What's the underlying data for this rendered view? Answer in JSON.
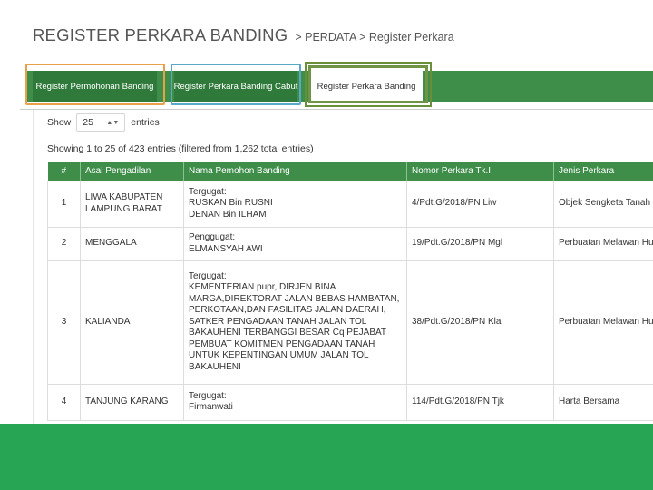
{
  "page": {
    "title": "REGISTER PERKARA BANDING",
    "breadcrumb": "> PERDATA > Register Perkara"
  },
  "tabs": [
    {
      "label": "Register Permohonan Banding",
      "active": false
    },
    {
      "label": "Register Perkara Banding Cabut",
      "active": false
    },
    {
      "label": "Register Perkara Banding",
      "active": true
    }
  ],
  "highlight_colors": {
    "orange": "#e8a04a",
    "blue": "#5aa8c8",
    "green": "#6a8f3a"
  },
  "length_menu": {
    "show_label": "Show",
    "value": "25",
    "entries_label": "entries"
  },
  "info": "Showing 1 to 25 of 423 entries (filtered from 1,262 total entries)",
  "table": {
    "columns": [
      "#",
      "Asal Pengadilan",
      "Nama Pemohon Banding",
      "Nomor Perkara Tk.I",
      "Jenis Perkara"
    ],
    "rows": [
      {
        "num": "1",
        "court": "LIWA KABUPATEN\nLAMPUNG BARAT",
        "names": "Tergugat:\nRUSKAN Bin RUSNI\nDENAN Bin ILHAM",
        "case_no": "4/Pdt.G/2018/PN Liw",
        "type": "Objek Sengketa Tanah"
      },
      {
        "num": "2",
        "court": "MENGGALA",
        "names": "Penggugat:\nELMANSYAH AWI",
        "case_no": "19/Pdt.G/2018/PN Mgl",
        "type": "Perbuatan Melawan Hukum"
      },
      {
        "num": "3",
        "court": "KALIANDA",
        "names": "Tergugat:\nKEMENTERIAN pupr, DIRJEN BINA\nMARGA,DIREKTORAT JALAN BEBAS HAMBATAN,\nPERKOTAAN,DAN FASILITAS JALAN DAERAH,\nSATKER PENGADAAN TANAH JALAN TOL\nBAKAUHENI TERBANGGI BESAR Cq PEJABAT\nPEMBUAT KOMITMEN PENGADAAN TANAH\nUNTUK KEPENTINGAN UMUM JALAN TOL\nBAKAUHENI",
        "case_no": "38/Pdt.G/2018/PN Kla",
        "type": "Perbuatan Melawan Hukum"
      },
      {
        "num": "4",
        "court": "TANJUNG KARANG",
        "names": "Tergugat:\nFirmanwati",
        "case_no": "114/Pdt.G/2018/PN Tjk",
        "type": "Harta Bersama"
      }
    ]
  },
  "colors": {
    "accent_green": "#3e8e4a",
    "footer_green": "#27a454"
  }
}
